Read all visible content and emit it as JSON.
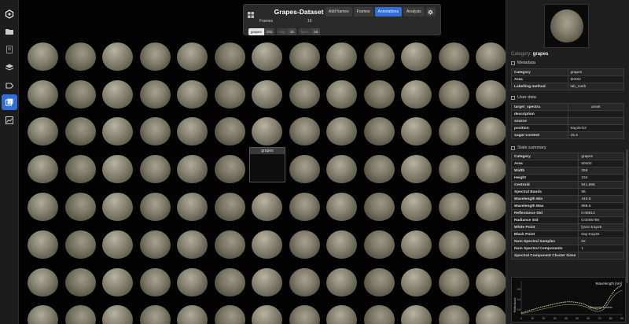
{
  "rail": {
    "items": [
      {
        "icon": "logo-icon"
      },
      {
        "icon": "folder-icon"
      },
      {
        "icon": "document-icon"
      },
      {
        "icon": "layers-icon"
      },
      {
        "icon": "tag-icon"
      },
      {
        "icon": "gallery-icon",
        "active": true
      },
      {
        "icon": "chart-icon"
      }
    ]
  },
  "toolbar": {
    "title": "Grapes-Dataset",
    "frames_label": "Frames",
    "frames_value": "16",
    "buttons": [
      "Add frames",
      "Frames",
      "Annotations",
      "Analysis"
    ],
    "active_button": "Annotations",
    "chips": [
      {
        "name": "grapes",
        "count": "192",
        "on": true
      },
      {
        "name": "tray",
        "count": "16",
        "on": false
      },
      {
        "name": "lyvec",
        "count": "16",
        "on": false
      }
    ]
  },
  "gallery": {
    "selected_label": "grapes"
  },
  "panel": {
    "category_label": "Category:",
    "category_value": "grapes",
    "metadata": {
      "title": "Metadata",
      "rows": [
        {
          "k": "Category",
          "v": "grapes"
        },
        {
          "k": "Area",
          "v": "50402"
        },
        {
          "k": "Labelling method",
          "v": "lab_meth"
        }
      ]
    },
    "user_data": {
      "title": "User data",
      "rows": [
        {
          "k": "target_spectra",
          "v": "unset"
        },
        {
          "k": "description",
          "v": ""
        },
        {
          "k": "source",
          "v": ""
        },
        {
          "k": "position",
          "v": "tray25-b2"
        },
        {
          "k": "sugar-content",
          "v": "15.4"
        }
      ]
    },
    "stats": {
      "title": "Stats summary",
      "rows": [
        {
          "k": "Category",
          "v": "grapes"
        },
        {
          "k": "Area",
          "v": "50402"
        },
        {
          "k": "Width",
          "v": "259"
        },
        {
          "k": "Height",
          "v": "234"
        },
        {
          "k": "Centroid",
          "v": "941,968"
        },
        {
          "k": "Spectral Bands",
          "v": "96"
        },
        {
          "k": "Wavelength Min",
          "v": "440.9"
        },
        {
          "k": "Wavelength Max",
          "v": "898.5"
        },
        {
          "k": "Reflectance Std",
          "v": "0.08813"
        },
        {
          "k": "Radiance Std",
          "v": "0.0005789"
        },
        {
          "k": "White Point",
          "v": "lyvec-tray25"
        },
        {
          "k": "Black Point",
          "v": "tray-tray25"
        },
        {
          "k": "Num Spectral Samples",
          "v": "62"
        },
        {
          "k": "Num Spectral Components",
          "v": "1"
        },
        {
          "k": "Spectral Component Cluster Sizes",
          "v": ""
        }
      ]
    },
    "chart": {
      "legend": "Wavelength [nm]",
      "xlabel": "Channel number",
      "ylabel": "Reflectance",
      "xticks": [
        "0",
        "10",
        "20",
        "30",
        "40",
        "50",
        "60",
        "70",
        "80",
        "90"
      ],
      "yticks": [
        "0.2",
        "0.4",
        "0.6"
      ]
    }
  },
  "colors": {
    "accent": "#2f6fd6",
    "panel_bg": "#1f1f1f",
    "curve": "#d8e0a0"
  }
}
